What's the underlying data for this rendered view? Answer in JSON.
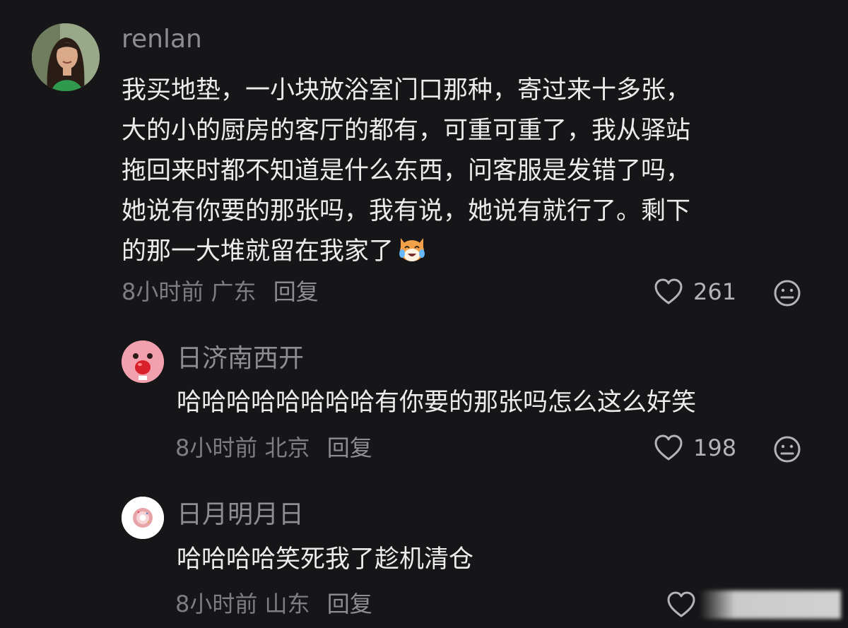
{
  "comments": [
    {
      "username": "renlan",
      "avatar_icon": "woman-portrait-avatar",
      "lines": [
        "我买地垫，一小块放浴室门口那种，寄过来十多张，",
        "大的小的厨房的客厅的都有，可重可重了，我从驿站",
        "拖回来时都不知道是什么东西，问客服是发错了吗，",
        "她说有你要的那张吗，我有说，她说有就行了。剩下",
        "的那一大堆就留在我家了"
      ],
      "inline_emoji": "laughing-cat-emoji",
      "time": "8小时前",
      "location": "广东",
      "reply_label": "回复",
      "likes": "261"
    },
    {
      "username": "日济南西开",
      "avatar_icon": "pink-cartoon-avatar",
      "lines": [
        "哈哈哈哈哈哈哈哈有你要的那张吗怎么这么好笑"
      ],
      "time": "8小时前",
      "location": "北京",
      "reply_label": "回复",
      "likes": "198"
    },
    {
      "username": "日月明月日",
      "avatar_icon": "donut-avatar",
      "lines": [
        "哈哈哈哈笑死我了趁机清仓"
      ],
      "time": "8小时前",
      "location": "山东",
      "reply_label": "回复",
      "likes": ""
    }
  ],
  "colors": {
    "background": "#161618",
    "text": "#ececec",
    "username": "#8e8e92",
    "meta": "#7d7d82"
  }
}
